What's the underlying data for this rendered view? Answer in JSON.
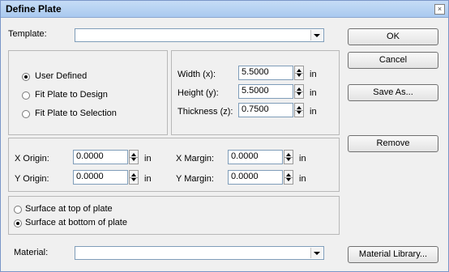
{
  "window": {
    "title": "Define Plate",
    "close_glyph": "×"
  },
  "template": {
    "label": "Template:",
    "value": ""
  },
  "mode": {
    "options": [
      "User Defined",
      "Fit Plate to Design",
      "Fit Plate to Selection"
    ],
    "selected": "User Defined"
  },
  "size": {
    "width_label": "Width (x):",
    "width_value": "5.5000",
    "height_label": "Height (y):",
    "height_value": "5.5000",
    "thickness_label": "Thickness (z):",
    "thickness_value": "0.7500",
    "unit": "in"
  },
  "origin": {
    "x_origin_label": "X Origin:",
    "x_origin_value": "0.0000",
    "y_origin_label": "Y Origin:",
    "y_origin_value": "0.0000",
    "x_margin_label": "X Margin:",
    "x_margin_value": "0.0000",
    "y_margin_label": "Y Margin:",
    "y_margin_value": "0.0000",
    "unit": "in"
  },
  "surface": {
    "options": [
      "Surface at top of plate",
      "Surface at bottom of plate"
    ],
    "selected": "Surface at bottom of plate"
  },
  "material": {
    "label": "Material:",
    "value": ""
  },
  "buttons": {
    "ok": "OK",
    "cancel": "Cancel",
    "save_as": "Save As...",
    "remove": "Remove",
    "material_library": "Material Library..."
  }
}
